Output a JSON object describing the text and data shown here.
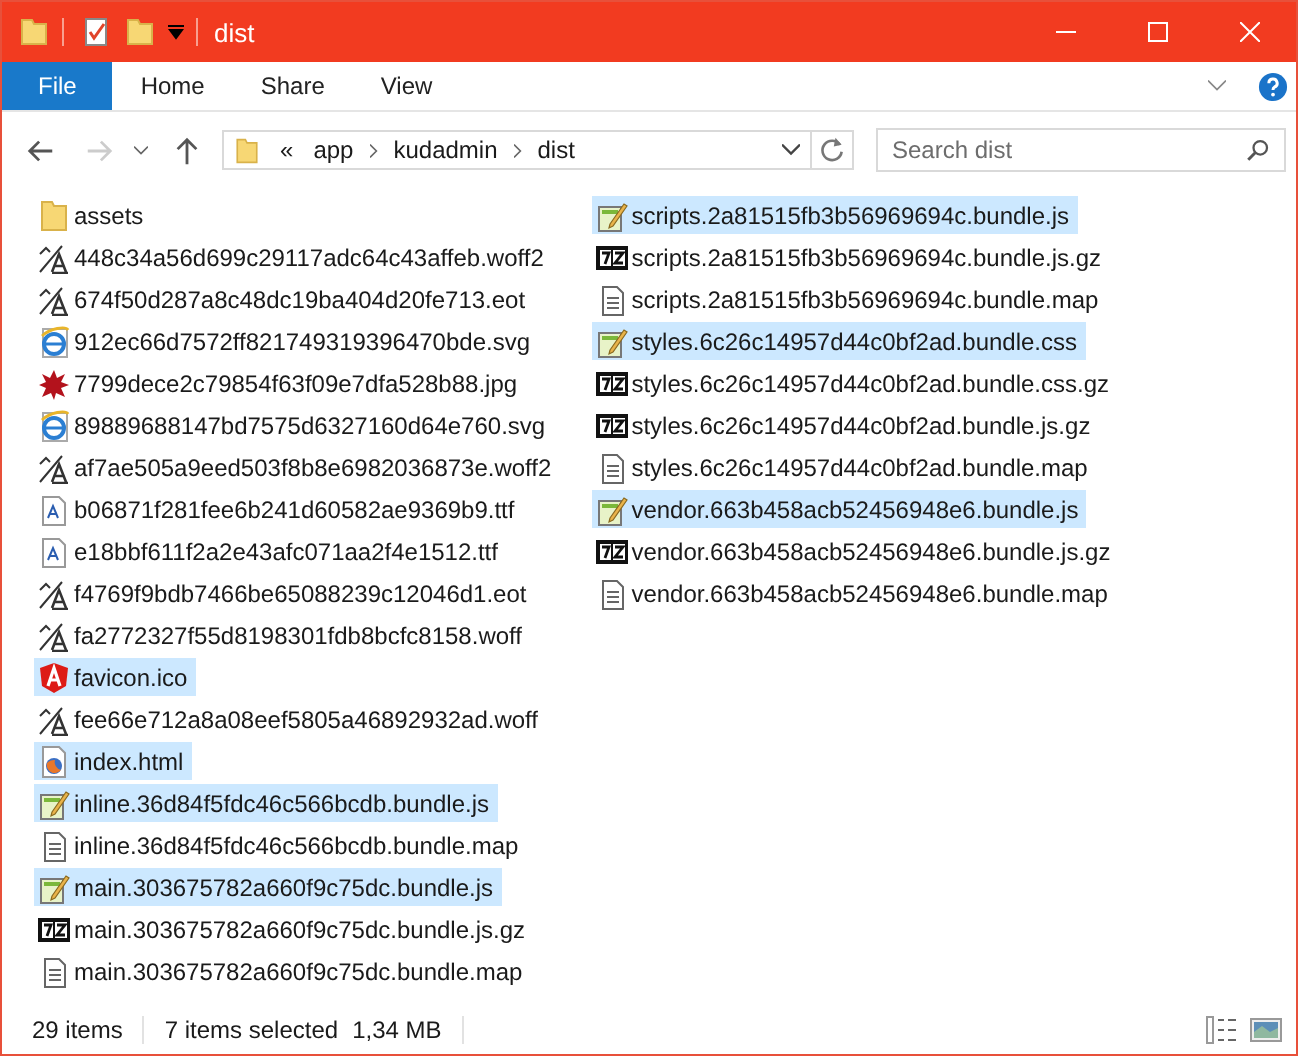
{
  "window": {
    "title": "dist"
  },
  "ribbon_tabs": [
    {
      "label": "File",
      "selected": true
    },
    {
      "label": "Home",
      "selected": false
    },
    {
      "label": "Share",
      "selected": false
    },
    {
      "label": "View",
      "selected": false
    }
  ],
  "address": {
    "crumbs": [
      "«",
      "app",
      "kudadmin",
      "dist"
    ]
  },
  "search": {
    "placeholder": "Search dist"
  },
  "files": [
    {
      "name": "assets",
      "kind": "folder",
      "selected": false
    },
    {
      "name": "448c34a56d699c29117adc64c43affeb.woff2",
      "kind": "font",
      "selected": false
    },
    {
      "name": "674f50d287a8c48dc19ba404d20fe713.eot",
      "kind": "font",
      "selected": false
    },
    {
      "name": "912ec66d7572ff821749319396470bde.svg",
      "kind": "web",
      "selected": false
    },
    {
      "name": "7799dece2c79854f63f09e7dfa528b88.jpg",
      "kind": "image",
      "selected": false
    },
    {
      "name": "89889688147bd7575d6327160d64e760.svg",
      "kind": "web",
      "selected": false
    },
    {
      "name": "af7ae505a9eed503f8b8e6982036873e.woff2",
      "kind": "font",
      "selected": false
    },
    {
      "name": "b06871f281fee6b241d60582ae9369b9.ttf",
      "kind": "truetype",
      "selected": false
    },
    {
      "name": "e18bbf611f2a2e43afc071aa2f4e1512.ttf",
      "kind": "truetype",
      "selected": false
    },
    {
      "name": "f4769f9bdb7466be65088239c12046d1.eot",
      "kind": "font",
      "selected": false
    },
    {
      "name": "fa2772327f55d8198301fdb8bcfc8158.woff",
      "kind": "font",
      "selected": false
    },
    {
      "name": "favicon.ico",
      "kind": "shield",
      "selected": true
    },
    {
      "name": "fee66e712a8a08eef5805a46892932ad.woff",
      "kind": "font",
      "selected": false
    },
    {
      "name": "index.html",
      "kind": "browser",
      "selected": true
    },
    {
      "name": "inline.36d84f5fdc46c566bcdb.bundle.js",
      "kind": "script",
      "selected": true
    },
    {
      "name": "inline.36d84f5fdc46c566bcdb.bundle.map",
      "kind": "text",
      "selected": false
    },
    {
      "name": "main.303675782a660f9c75dc.bundle.js",
      "kind": "script",
      "selected": true
    },
    {
      "name": "main.303675782a660f9c75dc.bundle.js.gz",
      "kind": "archive",
      "selected": false
    },
    {
      "name": "main.303675782a660f9c75dc.bundle.map",
      "kind": "text",
      "selected": false
    },
    {
      "name": "scripts.2a81515fb3b56969694c.bundle.js",
      "kind": "script",
      "selected": true
    },
    {
      "name": "scripts.2a81515fb3b56969694c.bundle.js.gz",
      "kind": "archive",
      "selected": false
    },
    {
      "name": "scripts.2a81515fb3b56969694c.bundle.map",
      "kind": "text",
      "selected": false
    },
    {
      "name": "styles.6c26c14957d44c0bf2ad.bundle.css",
      "kind": "script",
      "selected": true
    },
    {
      "name": "styles.6c26c14957d44c0bf2ad.bundle.css.gz",
      "kind": "archive",
      "selected": false
    },
    {
      "name": "styles.6c26c14957d44c0bf2ad.bundle.js.gz",
      "kind": "archive",
      "selected": false
    },
    {
      "name": "styles.6c26c14957d44c0bf2ad.bundle.map",
      "kind": "text",
      "selected": false
    },
    {
      "name": "vendor.663b458acb52456948e6.bundle.js",
      "kind": "script",
      "selected": true
    },
    {
      "name": "vendor.663b458acb52456948e6.bundle.js.gz",
      "kind": "archive",
      "selected": false
    },
    {
      "name": "vendor.663b458acb52456948e6.bundle.map",
      "kind": "text",
      "selected": false
    }
  ],
  "status_bar": {
    "count": "29 items",
    "selection": "7 items selected",
    "size": "1,34 MB"
  }
}
